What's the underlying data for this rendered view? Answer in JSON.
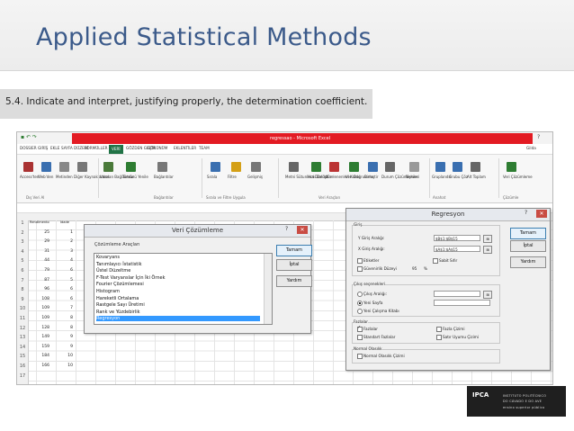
{
  "slide": {
    "title": "Applied Statistical Methods",
    "subtitle": "5.4. Indicate and interpret, justifying properly, the determination coefficient."
  },
  "excel": {
    "window_title": "regressao - Microsoft Excel",
    "user": "Gilda",
    "tabs": [
      "DOSSIER",
      "GIRİŞ",
      "EKLE",
      "SAYFA DÜZENİ",
      "FORMÜLLER",
      "VERİ",
      "GÖZDEN GEÇİR",
      "GÖRÜNÜM",
      "EKLENTİLER",
      "TEAM"
    ],
    "active_tab": "VERİ",
    "ribbon_items": [
      {
        "label": "Access'ten",
        "color": "#a33"
      },
      {
        "label": "Web'den",
        "color": "#3a6fb0"
      },
      {
        "label": "Metinden",
        "color": "#888"
      },
      {
        "label": "Diğer Kaynaklardan",
        "color": "#777"
      },
      {
        "label": "Varolan Bağlantılar",
        "color": "#4a7a3a"
      },
      {
        "label": "Tümünü Yenile",
        "color": "#2e7d32"
      },
      {
        "label": "Bağlantılar",
        "color": "#777"
      },
      {
        "label": "Sırala",
        "color": "#3a6fb0"
      },
      {
        "label": "Filtre",
        "color": "#d4a017"
      },
      {
        "label": "Gelişmiş",
        "color": "#777"
      },
      {
        "label": "Metni Sütunlara Dönüştür",
        "color": "#666"
      },
      {
        "label": "Hızlı Doldur",
        "color": "#2e7d32"
      },
      {
        "label": "Yinelenenleri Kaldır",
        "color": "#b33"
      },
      {
        "label": "Veri Doğrulama",
        "color": "#2e7d32"
      },
      {
        "label": "Birleştir",
        "color": "#3a6fb0"
      },
      {
        "label": "Durum Çözümlemesi",
        "color": "#666"
      },
      {
        "label": "İlişkiler",
        "color": "#999"
      },
      {
        "label": "Gruplandır",
        "color": "#3a6fb0"
      },
      {
        "label": "Grubu Çöz",
        "color": "#3a6fb0"
      },
      {
        "label": "Alt Toplam",
        "color": "#666"
      },
      {
        "label": "Veri Çözümleme",
        "color": "#2e7d32"
      }
    ],
    "group_labels": [
      "Dış Veri Al",
      "Bağlantılar",
      "Sırala ve Filtre Uygula",
      "Veri Araçları",
      "Anahat",
      "Çözümle"
    ],
    "rows": [
      "1",
      "2",
      "3",
      "4",
      "5",
      "6",
      "7",
      "8",
      "9",
      "10",
      "11",
      "12",
      "13",
      "14",
      "15",
      "16",
      "17"
    ],
    "col_a_header": "Rendimento",
    "col_b_header": "Idade",
    "data": [
      [
        "25",
        "1"
      ],
      [
        "29",
        "2"
      ],
      [
        "31",
        "3"
      ],
      [
        "44",
        "4"
      ],
      [
        "79",
        "6"
      ],
      [
        "87",
        "5"
      ],
      [
        "96",
        "6"
      ],
      [
        "108",
        "6"
      ],
      [
        "109",
        "7"
      ],
      [
        "109",
        "8"
      ],
      [
        "128",
        "8"
      ],
      [
        "149",
        "9"
      ],
      [
        "159",
        "9"
      ],
      [
        "184",
        "10"
      ],
      [
        "166",
        "10"
      ]
    ]
  },
  "dialog_analysis": {
    "title": "Veri Çözümleme",
    "group_label": "Çözümleme Araçları",
    "items": [
      "Kovaryans",
      "Tanımlayıcı İstatistik",
      "Üstel Düzeltme",
      "F-Test Varyanslar İçin İki Örnek",
      "Fourier Çözümlemesi",
      "Histogram",
      "Hareketli Ortalama",
      "Rastgele Sayı Üretimi",
      "Rank ve Yüzdebirlik",
      "Regresyon"
    ],
    "selected": "Regresyon",
    "ok": "Tamam",
    "cancel": "İptal",
    "help": "Yardım"
  },
  "dialog_regression": {
    "title": "Regresyon",
    "input_group": "Giriş",
    "y_range_label": "Y Giriş Aralığı:",
    "y_range_value": "$B$1:$B$15",
    "x_range_label": "X Giriş Aralığı:",
    "x_range_value": "$A$1:$A$15",
    "labels_chk": "Etiketler",
    "constant_zero": "Sabit Sıfır",
    "confidence_chk": "Güvenirlik Düzeyi",
    "confidence_value": "95",
    "confidence_unit": "%",
    "output_group": "Çıkış seçenekleri",
    "out_range": "Çıkış Aralığı:",
    "new_sheet": "Yeni Sayfa",
    "new_workbook": "Yeni Çalışma Kitabı",
    "residuals_group": "Fazlalar",
    "residuals": "Fazlalar",
    "std_residuals": "Standart Fazlalar",
    "residual_plots": "Fazla Çizimi",
    "line_fit": "Satır Uyumu Çizimi",
    "normal_group": "Normal Olasılık",
    "normal_plots": "Normal Olasılık Çizimi",
    "ok": "Tamam",
    "cancel": "İptal",
    "help": "Yardım"
  },
  "logo": {
    "mark": "IPCA",
    "line1": "INSTITUTO POLITÉCNICO",
    "line2": "DO CÁVADO E DO AVE",
    "line3": "ensino superior público"
  }
}
